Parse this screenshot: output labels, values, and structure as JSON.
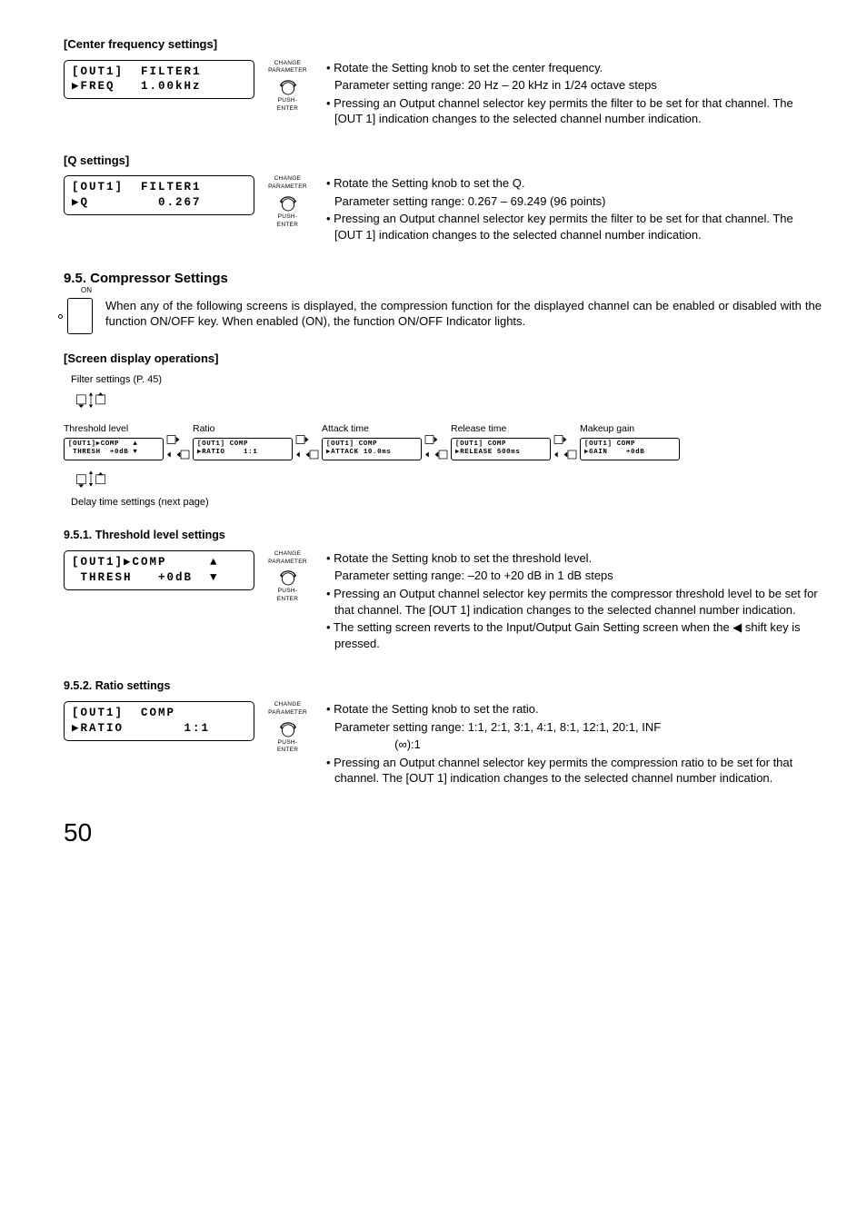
{
  "center_freq": {
    "heading": "[Center frequency settings]",
    "lcd_l1": "[OUT1]  FILTER1",
    "lcd_l2": "▶FREQ   1.00kHz",
    "knob_top": "CHANGE\nPARAMETER",
    "knob_bottom": "PUSH-ENTER",
    "b1": "• Rotate the Setting knob to set the center frequency.",
    "b1b": "Parameter setting range: 20 Hz – 20 kHz in 1/24 octave steps",
    "b2": "• Pressing an Output channel selector key permits the filter to be set for that channel. The [OUT 1] indication changes to the selected channel number indication."
  },
  "q": {
    "heading": "[Q settings]",
    "lcd_l1": "[OUT1]  FILTER1",
    "lcd_l2": "▶Q        0.267",
    "b1": "• Rotate the Setting knob to set the Q.",
    "b1b": "Parameter setting range: 0.267 – 69.249 (96 points)",
    "b2": "• Pressing an Output channel selector key permits the filter to be set for that channel. The [OUT 1] indication changes to the selected channel number indication."
  },
  "comp": {
    "heading": "9.5. Compressor Settings",
    "on_label": "ON",
    "intro": "When any of the following screens is displayed, the compression function for the displayed channel can be enabled or disabled with the function ON/OFF key. When enabled (ON), the function ON/OFF Indicator lights.",
    "screen_ops": "[Screen display operations]",
    "filter_ref": "Filter settings (P. 45)",
    "delay_ref": "Delay time settings (next page)",
    "flow": {
      "threshold": {
        "label": "Threshold level",
        "l1": "[OUT1]▶COMP   ▲",
        "l2": " THRESH  +0dB ▼"
      },
      "ratio": {
        "label": "Ratio",
        "l1": "[OUT1] COMP",
        "l2": "▶RATIO    1:1"
      },
      "attack": {
        "label": "Attack time",
        "l1": "[OUT1] COMP",
        "l2": "▶ATTACK 10.0ms"
      },
      "release": {
        "label": "Release time",
        "l1": "[OUT1] COMP",
        "l2": "▶RELEASE 500ms"
      },
      "makeup": {
        "label": "Makeup gain",
        "l1": "[OUT1] COMP",
        "l2": "▶GAIN    +0dB"
      }
    }
  },
  "threshold": {
    "heading": "9.5.1. Threshold level settings",
    "lcd_l1": "[OUT1]▶COMP     ▲",
    "lcd_l2": " THRESH   +0dB  ▼",
    "b1": "• Rotate the Setting knob to set the threshold level.",
    "b1b": "Parameter setting range: –20 to +20 dB in 1 dB steps",
    "b2": "• Pressing an Output channel selector key permits the compressor threshold level to be set for that channel. The [OUT 1] indication changes to the selected channel number indication.",
    "b3": "• The setting screen reverts to the Input/Output Gain Setting screen when the  ◀  shift key is pressed."
  },
  "ratio": {
    "heading": "9.5.2. Ratio settings",
    "lcd_l1": "[OUT1]  COMP",
    "lcd_l2": "▶RATIO       1:1",
    "b1": "• Rotate the Setting knob to set the ratio.",
    "b1b": "Parameter setting range: 1:1, 2:1, 3:1, 4:1, 8:1, 12:1, 20:1, INF",
    "b1c": "(∞):1",
    "b2": "• Pressing an Output channel selector key permits the compression ratio to be set for that channel. The [OUT 1] indication changes to the selected channel number indication."
  },
  "page_number": "50"
}
